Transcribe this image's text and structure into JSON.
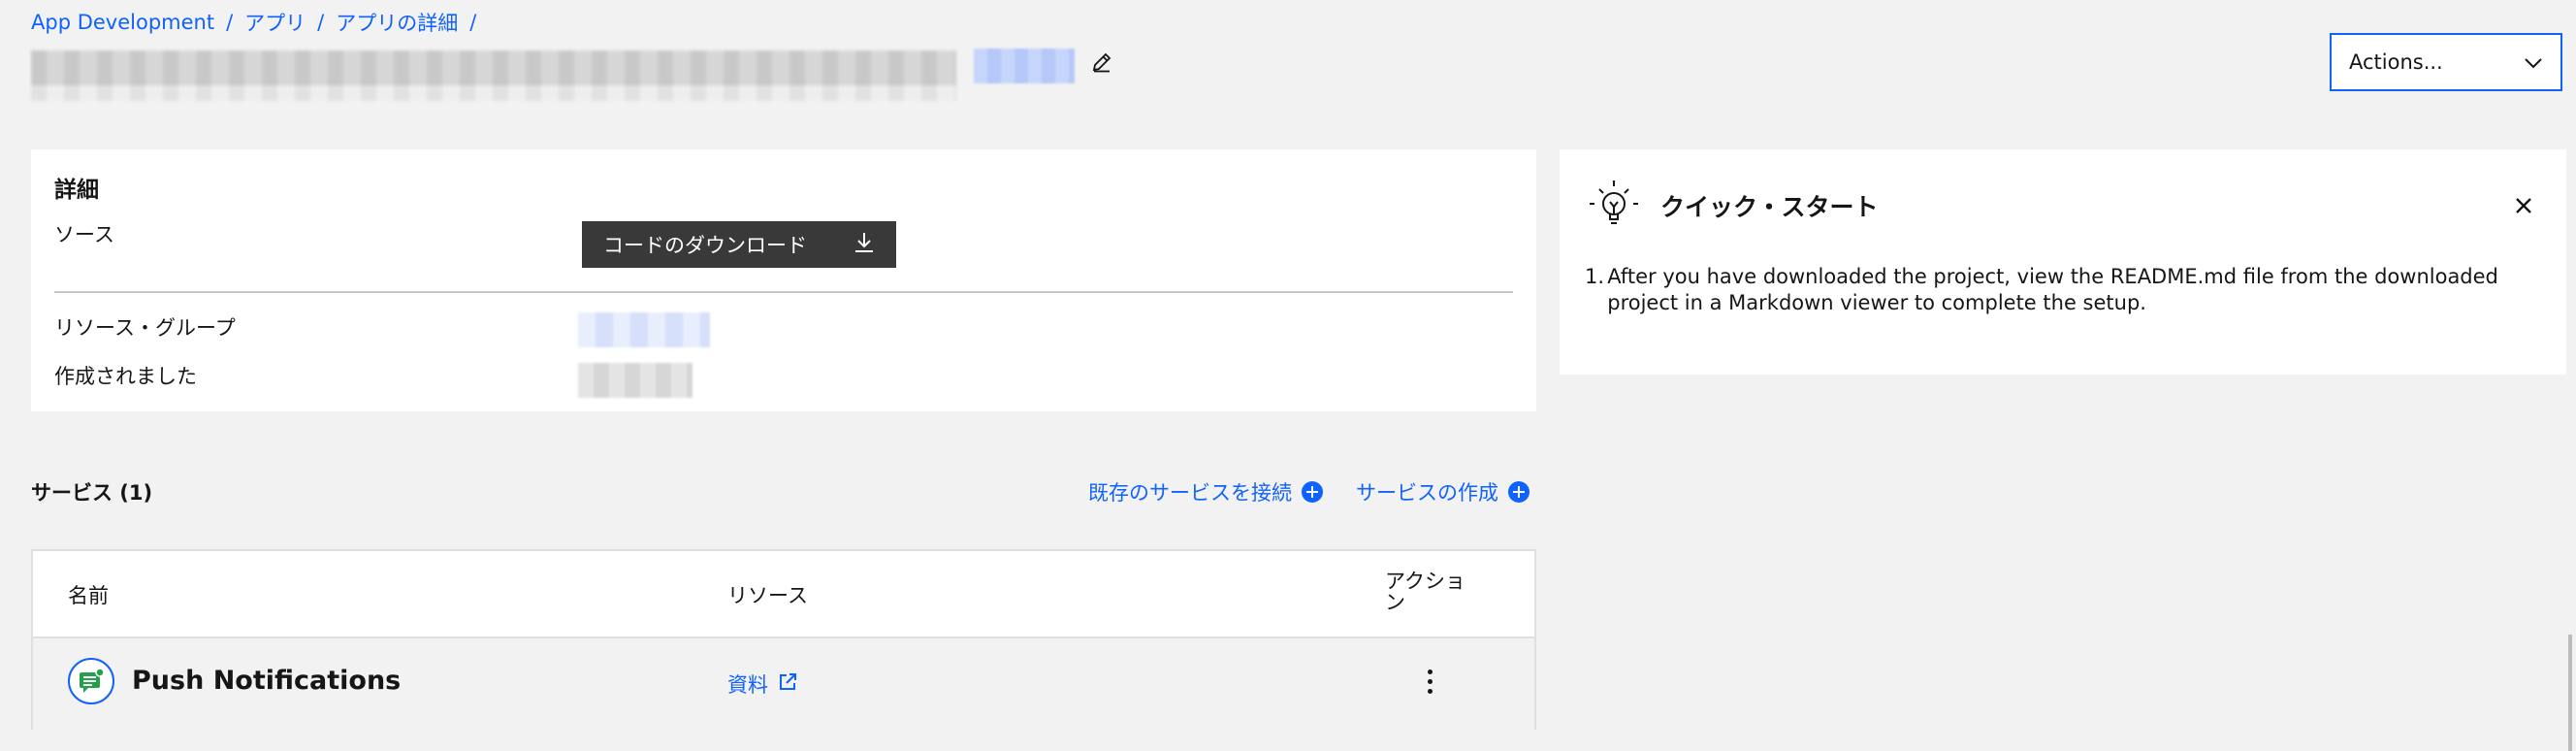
{
  "breadcrumb": {
    "items": [
      "App Development",
      "アプリ",
      "アプリの詳細"
    ],
    "separator": "/"
  },
  "header": {
    "actions_label": "Actions..."
  },
  "details": {
    "heading": "詳細",
    "source_label": "ソース",
    "download_button": "コードのダウンロード",
    "resource_group_label": "リソース・グループ",
    "created_label": "作成されました"
  },
  "quick_start": {
    "title": "クイック・スタート",
    "steps": [
      {
        "number": "1.",
        "text": "After you have downloaded the project, view the README.md file from the downloaded project in a Markdown viewer to complete the setup."
      }
    ]
  },
  "services": {
    "title": "サービス (1)",
    "connect_link": "既存のサービスを接続",
    "create_link": "サービスの作成",
    "columns": [
      "名前",
      "リソース",
      "アクション"
    ],
    "rows": [
      {
        "name": "Push Notifications",
        "resource_link": "資料",
        "icon": "push-notifications-icon"
      }
    ]
  },
  "colors": {
    "accent": "#0f62fe",
    "background": "#f2f2f2",
    "card": "#ffffff",
    "dark_button": "#393939",
    "service_icon": "#24a148"
  }
}
